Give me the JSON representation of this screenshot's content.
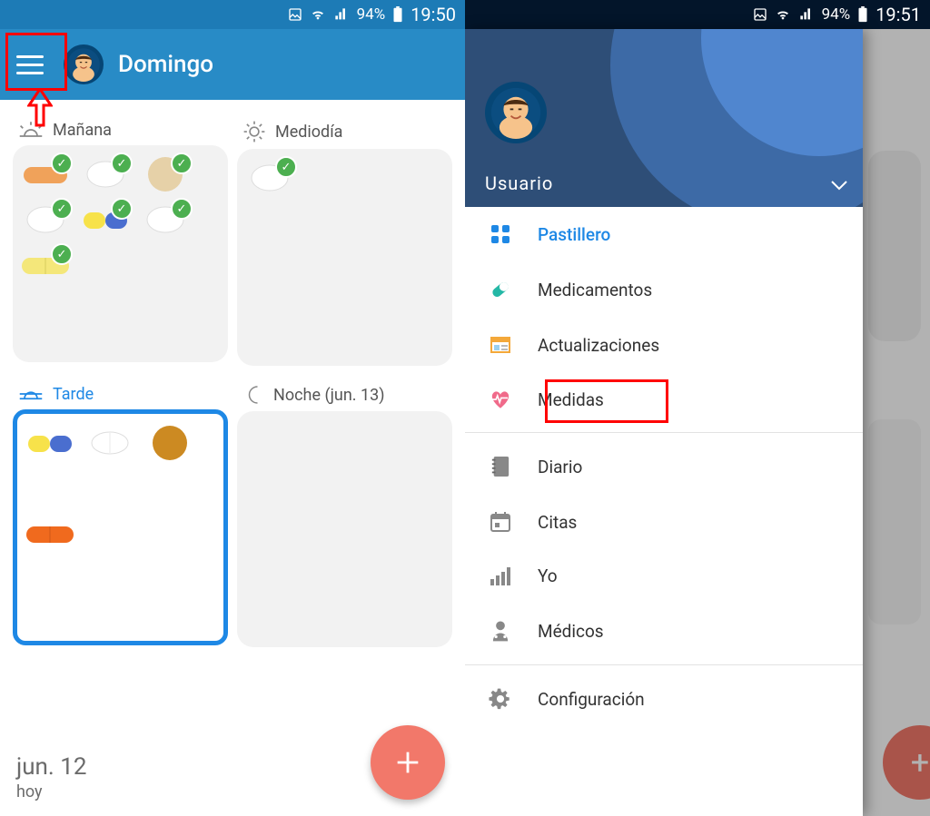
{
  "statusLeft": {
    "battery": "94%",
    "time": "19:50"
  },
  "statusRight": {
    "battery": "94%",
    "time": "19:51"
  },
  "header": {
    "title": "Domingo"
  },
  "sections": {
    "morning": {
      "icon": "sunrise",
      "label": "Mañana"
    },
    "noon": {
      "icon": "sun",
      "label": "Mediodía"
    },
    "afternoon": {
      "icon": "sunset",
      "label": "Tarde"
    },
    "night": {
      "icon": "moon",
      "label": "Noche (jun. 13)"
    }
  },
  "footer": {
    "date": "jun. 12",
    "rel": "hoy"
  },
  "ghost": {
    "nightLabel": "3)"
  },
  "drawer": {
    "userName": "Usuario",
    "items": [
      {
        "icon": "grid",
        "label": "Pastillero",
        "active": true
      },
      {
        "icon": "pill",
        "label": "Medicamentos"
      },
      {
        "icon": "news",
        "label": "Actualizaciones"
      },
      {
        "icon": "heart",
        "label": "Medidas",
        "highlighted": true
      },
      {
        "sep": true
      },
      {
        "icon": "journal",
        "label": "Diario"
      },
      {
        "icon": "calendar",
        "label": "Citas"
      },
      {
        "icon": "bars",
        "label": "Yo"
      },
      {
        "icon": "doctor",
        "label": "Médicos"
      },
      {
        "sep": true
      },
      {
        "icon": "gear",
        "label": "Configuración"
      }
    ]
  }
}
